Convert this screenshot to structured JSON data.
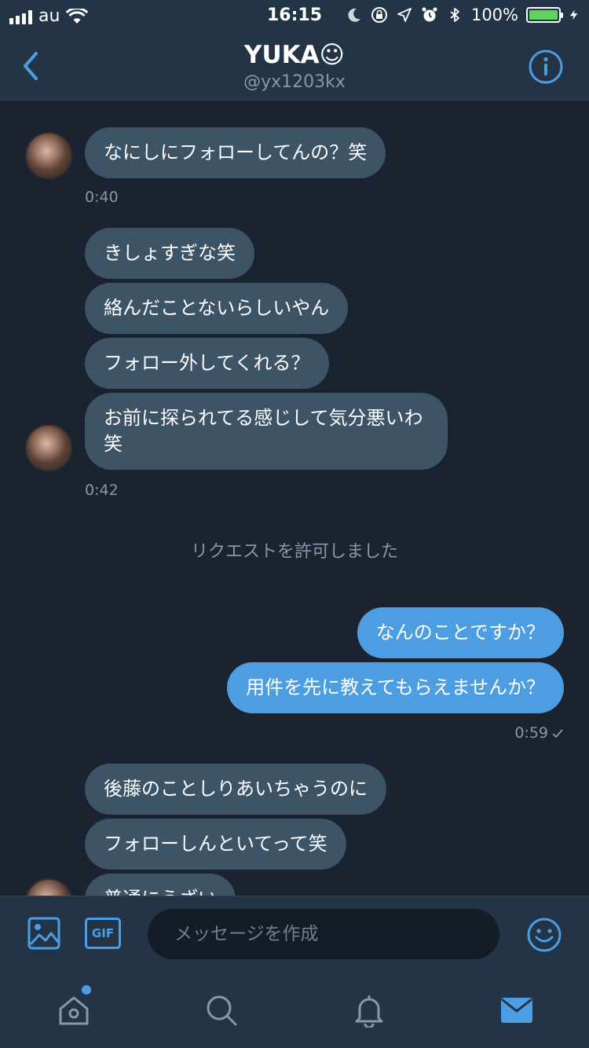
{
  "status_bar": {
    "carrier": "au",
    "time": "16:15",
    "battery": "100%",
    "battery_level": 1.0,
    "icons": [
      "signal-icon",
      "wifi-icon",
      "moon-icon",
      "rotation-lock-icon",
      "location-icon",
      "alarm-icon",
      "bluetooth-icon",
      "battery-icon",
      "charging-icon"
    ]
  },
  "header": {
    "title": "YUKA☺",
    "handle": "@yx1203kx",
    "icons": [
      "back-chevron-icon",
      "info-icon"
    ]
  },
  "messages": [
    {
      "side": "in",
      "text": "なにしにフォローしてんの？笑"
    },
    {
      "side": "time",
      "text": "0:40"
    },
    {
      "side": "in",
      "text": "きしょすぎな笑"
    },
    {
      "side": "in",
      "text": "絡んだことないらしいやん"
    },
    {
      "side": "in",
      "text": "フォロー外してくれる？"
    },
    {
      "side": "in",
      "text": "お前に探られてる感じして気分悪いわ笑"
    },
    {
      "side": "time",
      "text": "0:42"
    },
    {
      "side": "system",
      "text": "リクエストを許可しました"
    },
    {
      "side": "out",
      "text": "なんのことですか？"
    },
    {
      "side": "out",
      "text": "用件を先に教えてもらえませんか？"
    },
    {
      "side": "time",
      "text": "0:59"
    },
    {
      "side": "in",
      "text": "後藤のことしりあいちゃうのに"
    },
    {
      "side": "in",
      "text": "フォローしんといてって笑"
    },
    {
      "side": "in",
      "text": "普通にうざい"
    }
  ],
  "composer": {
    "placeholder": "メッセージを作成",
    "gif_label": "GIF",
    "icons": [
      "image-icon",
      "emoji-icon"
    ]
  },
  "tab_bar": {
    "icons": [
      "home-icon",
      "search-icon",
      "notifications-icon",
      "messages-icon"
    ],
    "home_has_badge": true
  },
  "colors": {
    "accent": "#4d9de3",
    "background": "#1b2330",
    "bar": "#243447",
    "incoming_bubble": "#3d5366",
    "outgoing_bubble": "#4d9de3",
    "muted_text": "#8899a6"
  }
}
